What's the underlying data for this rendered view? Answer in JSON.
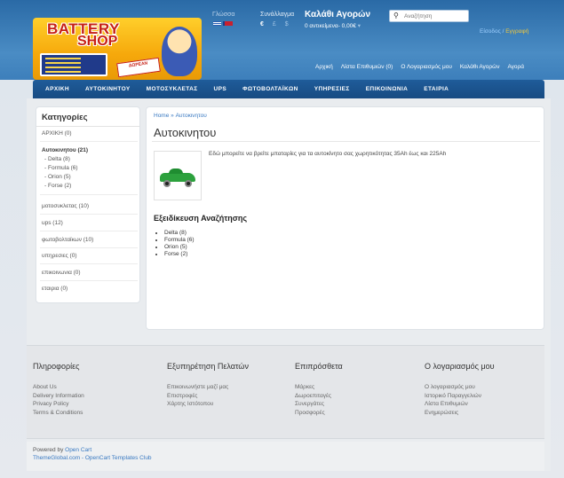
{
  "header": {
    "logo": {
      "line1": "BATTERY",
      "line2": "SHOP",
      "tag": "ΔΩΡΕΑΝ"
    },
    "language_label": "Γλώσσα",
    "currency_label": "Συνάλλαγμα",
    "currency_symbols": [
      "€",
      "£",
      "$"
    ],
    "cart_title": "Καλάθι Αγορών",
    "cart_summary": "0 αντικείμενα- 0,00€",
    "search_placeholder": "Αναζήτηση",
    "login": "Είσοδος",
    "register": "Εγγραφή",
    "top_links": [
      "Αρχική",
      "Λίστα Επιθυμιών (0)",
      "Ο Λογαριασμός μου",
      "Καλάθι Αγορών",
      "Αγορά"
    ]
  },
  "nav": [
    "ΑΡΧΙΚΗ",
    "ΑΥΤΟΚΙΝΗΤΟΥ",
    "ΜΟΤΟΣΥΚΛΕΤΑΣ",
    "UPS",
    "ΦΩΤΟΒΟΛΤΑΪΚΩΝ",
    "ΥΠΗΡΕΣΙΕΣ",
    "ΕΠΙΚΟΙΝΩΝΙΑ",
    "ΕΤΑΙΡΙΑ"
  ],
  "sidebar": {
    "title": "Κατηγορίες",
    "items": [
      "ΑΡΧΙΚΗ (0)",
      "Αυτοκινητου (21)",
      "- Delta (8)",
      "- Formula (6)",
      "- Orion (5)",
      "- Forse (2)",
      "μοτοσυκλετας (10)",
      "ups (12)",
      "φωτοβολταϊκων (10)",
      "υπηρεσιες (0)",
      "επικοινωνια (0)",
      "εταιρια (0)"
    ]
  },
  "main": {
    "breadcrumb": [
      "Home",
      "»",
      "Αυτοκινητου"
    ],
    "title": "Αυτοκινητου",
    "description": "Εδώ μπορείτε να βρείτε μπαταρίες για τα αυτοκίνητο σας χωρητικότητας 35Ah έως και 225Ah",
    "refine_title": "Εξειδίκευση Αναζήτησης",
    "refine_items": [
      "Delta (8)",
      "Formula (6)",
      "Orion (5)",
      "Forse (2)"
    ]
  },
  "footer": {
    "columns": [
      {
        "title": "Πληροφορίες",
        "links": [
          "About Us",
          "Delivery Information",
          "Privacy Policy",
          "Terms & Conditions"
        ]
      },
      {
        "title": "Εξυπηρέτηση Πελατών",
        "links": [
          "Επικοινωνήστε μαζί μας",
          "Επιστροφές",
          "Χάρτης Ιστότοπου"
        ]
      },
      {
        "title": "Επιπρόσθετα",
        "links": [
          "Μάρκες",
          "Δωροεπιταγές",
          "Συνεργάτες",
          "Προσφορές"
        ]
      },
      {
        "title": "Ο λογαριασμός μου",
        "links": [
          "Ο λογαριασμός μου",
          "Ιστορικό Παραγγελιών",
          "Λίστα Επιθυμιών",
          "Ενημερώσεις"
        ]
      }
    ],
    "powered_prefix": "Powered by",
    "powered_link": "Open Cart",
    "credit": "ThemeGlobal.com - OpenCart Templates Club"
  }
}
